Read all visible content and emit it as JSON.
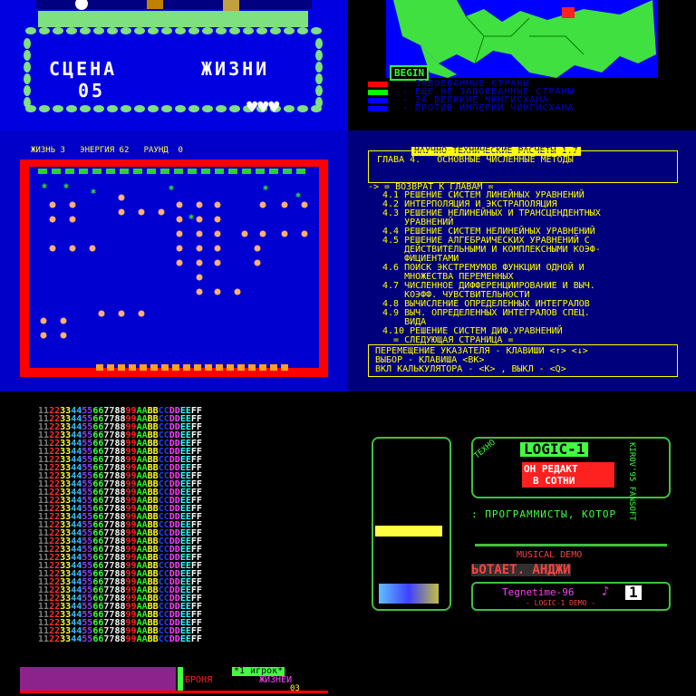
{
  "scene_panel": {
    "scene_label": "СЦЕНА",
    "scene_value": "05",
    "lives_label": "ЖИЗНИ"
  },
  "map_panel": {
    "begin_button": "BEGIN",
    "legend": [
      {
        "color": "#ff0000",
        "text": "- ЗАВОЕВАННЫЕ СТРАНЫ"
      },
      {
        "color": "#00ff00",
        "text": "- ЕЩЕ НЕ ЗАВОЕВАННЫЕ СТРАНЫ"
      },
      {
        "color": "#0000ff",
        "text": "- ЗА ВЕЛИКИЕ ЧИНГИСХАНА"
      },
      {
        "color": "#0000ff",
        "text": "- ПРОТИВ ИМПЕРИИ ЧИНГИСХАНА"
      }
    ]
  },
  "arcade_panel": {
    "hud": "ЖИЗНЬ 3   ЭНЕРГИЯ 62   РАУНД  0"
  },
  "menu_panel": {
    "title": "НАУЧНО-ТЕХНИЧЕСКИЕ РАСЧЕТЫ 1.7",
    "chapter": "ГЛАВА 4.   ОСНОВНЫЕ ЧИСЛЕННЫЕ МЕТОДЫ",
    "back": "-> = ВОЗВРАТ К ГЛАВАМ =",
    "items": [
      "4.1 РЕШЕНИЕ СИСТЕМ ЛИНЕЙНЫХ УРАВНЕНИЙ",
      "4.2 ИНТЕРПОЛЯЦИЯ И ЭКСТРАПОЛЯЦИЯ",
      "4.3 РЕШЕНИЕ НЕЛИНЕЙНЫХ И ТРАНСЦЕНДЕНТНЫХ",
      "    УРАВНЕНИЙ",
      "4.4 РЕШЕНИЕ СИСТЕМ НЕЛИНЕЙНЫХ УРАВНЕНИЙ",
      "4.5 РЕШЕНИЕ АЛГЕБРАИЧЕСКИХ УРАВНЕНИЙ С",
      "    ДЕЙСТВИТЕЛЬНЫМИ И КОМПЛЕКСНЫМИ КОЭФ-",
      "    ФИЦИЕНТАМИ",
      "4.6 ПОИСК ЭКСТРЕМУМОВ ФУНКЦИИ ОДНОЙ И",
      "    МНОЖЕСТВА ПЕРЕМЕННЫХ",
      "4.7 ЧИСЛЕННОЕ ДИФФЕРЕНЦИИРОВАНИЕ И ВЫЧ.",
      "    КОЭФФ. ЧУВСТВИТЕЛЬНОСТИ",
      "4.8 ВЫЧИСЛЕНИЕ ОПРЕДЕЛЕННЫХ ИНТЕГРАЛОВ",
      "4.9 ВЫЧ. ОПРЕДЕЛЕННЫХ ИНТЕГРАЛОВ СПЕЦ.",
      "    ВИДА",
      "4.10 РЕШЕНИЕ СИСТЕМ ДИФ.УРАВНЕНИЙ",
      "  = СЛЕДУЮЩАЯ СТРАНИЦА ="
    ],
    "help": [
      "ПЕРЕМЕЩЕНИЕ УКАЗАТЕЛЯ - КЛАВИШИ <↑> <↓>",
      "ВЫБОР - КЛАВИША <ВК>",
      "ВКЛ КАЛЬКУЛЯТОРА - <К> , ВЫКЛ - <Q>"
    ]
  },
  "test_panel": {
    "row_text": "112233445566778899AABBCCDDEEFF",
    "row_count": 29,
    "colors": [
      "#7f7f7f",
      "#ff3030",
      "#ffff40",
      "#30c0ff",
      "#9040ff",
      "#40ff40",
      "#e0e0e0",
      "#ffffff",
      "#ff2020",
      "#20ff20",
      "#ffff20",
      "#2040ff",
      "#ff40ff",
      "#30ffff",
      "#ffffff"
    ],
    "player": "*1 игрок*",
    "armor": "БРОНЯ",
    "lives": "ЖИЗНЕИ",
    "lives_value": "03"
  },
  "demo_panel": {
    "brand_v1": "ТЕХНО",
    "logo": "LOGIC-1",
    "side_text": "KIROV'95 FANSOFT",
    "banner1": "ОН РЕДАКТ",
    "banner2": "В СОТНИ",
    "scroller": ": ПРОГРАММИСТЫ, КОТОР",
    "musical": "MUSICAL DEMO",
    "scroller2": "ЬОТАЕТ. АНДЖИ",
    "signature": "Tegnetime-96",
    "footer": "- LOGIC-1 DEMO -",
    "badge": "1"
  }
}
